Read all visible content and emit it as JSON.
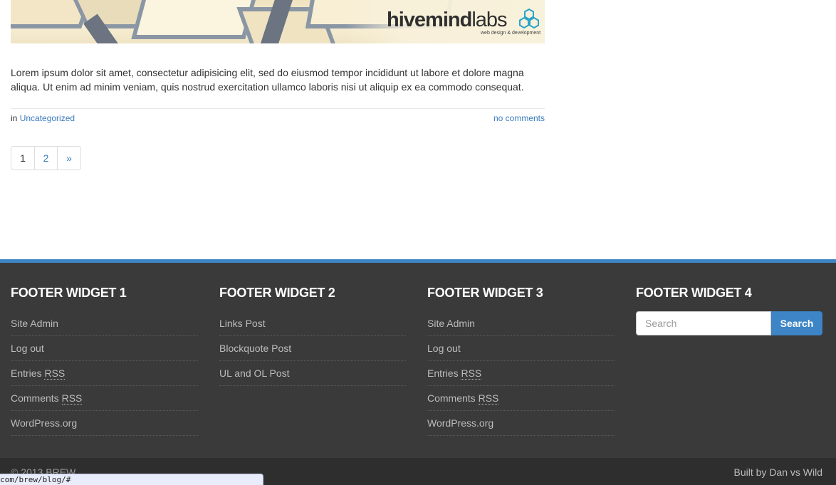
{
  "banner": {
    "brand_bold": "hivemind",
    "brand_light": "labs",
    "tagline": "web design & development"
  },
  "post": {
    "excerpt": "Lorem ipsum dolor sit amet, consectetur adipisicing elit, sed do eiusmod tempor incididunt ut labore et dolore magna aliqua. Ut enim ad minim veniam, quis nostrud exercitation ullamco laboris nisi ut aliquip ex ea commodo consequat.",
    "meta_prefix": "in",
    "category": "Uncategorized",
    "comments": "no comments"
  },
  "pagination": {
    "pages": [
      "1",
      "2"
    ],
    "next": "»"
  },
  "footer": {
    "widget1": {
      "title": "FOOTER WIDGET 1",
      "items": [
        "Site Admin",
        "Log out",
        "Entries",
        "Comments",
        "WordPress.org"
      ]
    },
    "widget2": {
      "title": "FOOTER WIDGET 2",
      "items": [
        "Links Post",
        "Blockquote Post",
        "UL and OL Post"
      ]
    },
    "widget3": {
      "title": "FOOTER WIDGET 3",
      "items": [
        "Site Admin",
        "Log out",
        "Entries",
        "Comments",
        "WordPress.org"
      ]
    },
    "widget4": {
      "title": "FOOTER WIDGET 4",
      "search_placeholder": "Search",
      "search_button": "Search"
    },
    "rss": "RSS",
    "copyright": "© 2013 BREW",
    "credit": "Built by Dan vs Wild"
  },
  "status_url": "com/brew/blog/#",
  "colors": {
    "accent": "#3d85c6",
    "footer_bg": "#3a3a3a",
    "link": "#3a7bbf"
  }
}
